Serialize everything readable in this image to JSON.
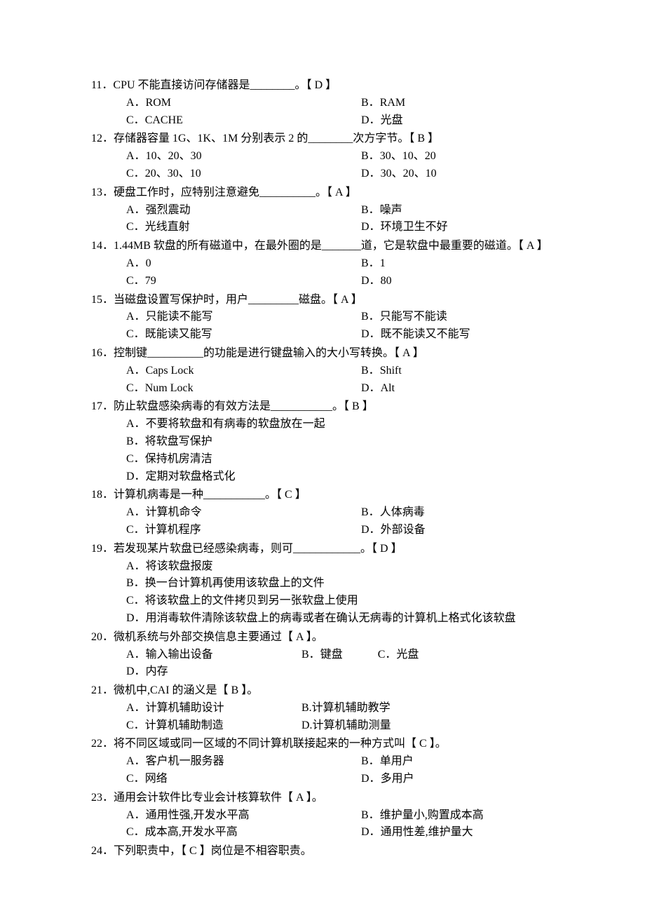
{
  "questions": [
    {
      "num": "11",
      "stem_pre": "．CPU 不能直接访问存储器是",
      "blank": "________",
      "stem_post": "。",
      "answer": "【 D 】",
      "options_layout": "cols2",
      "options": [
        {
          "label": "A．",
          "text": "ROM"
        },
        {
          "label": "B．",
          "text": "RAM"
        },
        {
          "label": "C．",
          "text": "CACHE"
        },
        {
          "label": "D．",
          "text": "光盘"
        }
      ]
    },
    {
      "num": "12",
      "stem_pre": "．存储器容量 1G、1K、1M 分别表示 2 的",
      "blank": "________",
      "stem_post": "次方字节。",
      "answer": "【 B 】",
      "options_layout": "cols2",
      "options": [
        {
          "label": "A．",
          "text": "10、20、30"
        },
        {
          "label": "B．",
          "text": "30、10、20"
        },
        {
          "label": "C．",
          "text": "20、30、10"
        },
        {
          "label": "D．",
          "text": "30、20、10"
        }
      ]
    },
    {
      "num": "13",
      "stem_pre": "．硬盘工作时，应特别注意避免",
      "blank": "__________",
      "stem_post": "。",
      "answer": "【 A 】",
      "options_layout": "cols2",
      "options": [
        {
          "label": "A．",
          "text": "强烈震动"
        },
        {
          "label": "B．",
          "text": "噪声"
        },
        {
          "label": "C．",
          "text": "光线直射"
        },
        {
          "label": "D．",
          "text": "环境卫生不好"
        }
      ]
    },
    {
      "num": "14",
      "stem_pre": "．1.44MB 软盘的所有磁道中，在最外圈的是",
      "blank": "_______",
      "stem_post": "道，它是软盘中最重要的磁道。",
      "answer": "【 A 】",
      "options_layout": "cols2",
      "options": [
        {
          "label": "A．",
          "text": "0"
        },
        {
          "label": "B．",
          "text": "1"
        },
        {
          "label": "C．",
          "text": "79"
        },
        {
          "label": "D．",
          "text": "80"
        }
      ]
    },
    {
      "num": "15",
      "stem_pre": "．当磁盘设置写保护时，用户",
      "blank": "_________",
      "stem_post": "磁盘。",
      "answer": "【 A 】",
      "options_layout": "cols2",
      "options": [
        {
          "label": "A．",
          "text": "只能读不能写"
        },
        {
          "label": "B．",
          "text": "只能写不能读"
        },
        {
          "label": "C．",
          "text": "既能读又能写"
        },
        {
          "label": "D．",
          "text": "既不能读又不能写"
        }
      ]
    },
    {
      "num": "16",
      "stem_pre": "．控制键",
      "blank": "__________",
      "stem_post": "的功能是进行键盘输入的大小写转换。",
      "answer": "【 A 】",
      "options_layout": "cols2",
      "options": [
        {
          "label": "A．",
          "text": "Caps Lock"
        },
        {
          "label": "B．",
          "text": "Shift"
        },
        {
          "label": "C．",
          "text": "Num Lock"
        },
        {
          "label": "D．",
          "text": "Alt"
        }
      ]
    },
    {
      "num": "17",
      "stem_pre": "．防止软盘感染病毒的有效方法是",
      "blank": "___________",
      "stem_post": "。",
      "answer": "【 B 】",
      "options_layout": "cols1",
      "options": [
        {
          "label": "A．",
          "text": "不要将软盘和有病毒的软盘放在一起"
        },
        {
          "label": "B．",
          "text": "将软盘写保护"
        },
        {
          "label": "C．",
          "text": "保持机房清洁"
        },
        {
          "label": "D．",
          "text": "定期对软盘格式化"
        }
      ]
    },
    {
      "num": "18",
      "stem_pre": "．计算机病毒是一种",
      "blank": "___________",
      "stem_post": "。",
      "answer": "【 C 】",
      "options_layout": "cols2",
      "options": [
        {
          "label": "A．",
          "text": "计算机命令"
        },
        {
          "label": "B．",
          "text": "人体病毒"
        },
        {
          "label": "C．",
          "text": "计算机程序"
        },
        {
          "label": "D．",
          "text": "外部设备"
        }
      ]
    },
    {
      "num": "19",
      "stem_pre": "．若发现某片软盘已经感染病毒，则可",
      "blank": "____________",
      "stem_post": "。",
      "answer": "【 D 】",
      "options_layout": "cols1",
      "options": [
        {
          "label": "A．",
          "text": "将该软盘报废"
        },
        {
          "label": "B．",
          "text": "换一台计算机再使用该软盘上的文件"
        },
        {
          "label": "C．",
          "text": "将该软盘上的文件拷贝到另一张软盘上使用"
        },
        {
          "label": "D．",
          "text": "用消毒软件清除该软盘上的病毒或者在确认无病毒的计算机上格式化该软盘"
        }
      ]
    },
    {
      "num": "20",
      "stem_pre": "．微机系统与外部交换信息主要通过",
      "blank": "",
      "stem_post": "",
      "answer": "【 A 】。",
      "options_layout": "narrow",
      "options": [
        {
          "label": "A．",
          "text": "输入输出设备"
        },
        {
          "label": "B．",
          "text": "键盘"
        },
        {
          "label": "C．",
          "text": "光盘"
        },
        {
          "label": "D．",
          "text": "内存"
        }
      ]
    },
    {
      "num": "21",
      "stem_pre": "．微机中,CAI 的涵义是",
      "blank": "",
      "stem_post": "",
      "answer": "【 B 】。",
      "options_layout": "narrow",
      "options": [
        {
          "label": "A．",
          "text": "计算机辅助设计"
        },
        {
          "label": "B.",
          "text": "计算机辅助教学"
        },
        {
          "label": "C．",
          "text": "计算机辅助制造"
        },
        {
          "label": "D.",
          "text": "计算机辅助测量"
        }
      ]
    },
    {
      "num": "22",
      "stem_pre": "．将不同区域或同一区域的不同计算机联接起来的一种方式叫",
      "blank": "",
      "stem_post": "",
      "answer": "【 C 】。",
      "options_layout": "cols2",
      "options": [
        {
          "label": "A．",
          "text": "客户机一服务器"
        },
        {
          "label": "B．",
          "text": "单用户"
        },
        {
          "label": "C．",
          "text": "网络"
        },
        {
          "label": "D．",
          "text": "多用户"
        }
      ]
    },
    {
      "num": "23",
      "stem_pre": "．通用会计软件比专业会计核算软件",
      "blank": "",
      "stem_post": "",
      "answer": "【 A 】。",
      "options_layout": "cols2",
      "options": [
        {
          "label": "A．",
          "text": "通用性强,开发水平高"
        },
        {
          "label": "B．",
          "text": "维护量小,购置成本高"
        },
        {
          "label": "C．",
          "text": "成本高,开发水平高"
        },
        {
          "label": "D．",
          "text": "通用性差,维护量大"
        }
      ]
    },
    {
      "num": "24",
      "stem_pre": "．下列职责中，",
      "blank": "",
      "stem_post": "岗位是不相容职责。",
      "answer_mid": "【 C 】",
      "options_layout": "none",
      "options": []
    }
  ]
}
